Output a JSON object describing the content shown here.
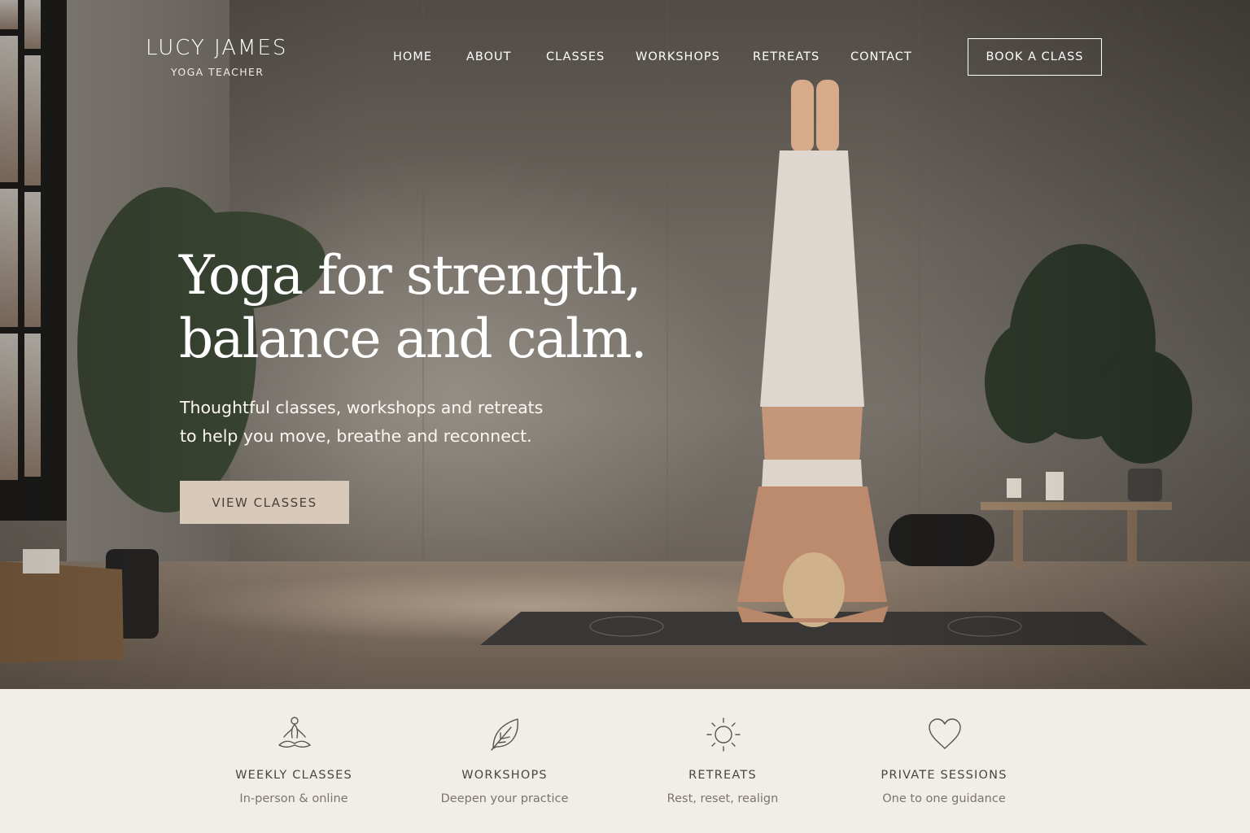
{
  "brand": {
    "name": "LUCY JAMES",
    "tagline": "YOGA TEACHER"
  },
  "nav": {
    "items": [
      {
        "label": "HOME"
      },
      {
        "label": "ABOUT"
      },
      {
        "label": "CLASSES"
      },
      {
        "label": "WORKSHOPS"
      },
      {
        "label": "RETREATS"
      },
      {
        "label": "CONTACT"
      }
    ],
    "cta_label": "BOOK A CLASS"
  },
  "hero": {
    "headline_line1": "Yoga for strength,",
    "headline_line2": "balance and calm.",
    "subtext_line1": "Thoughtful classes, workshops and retreats",
    "subtext_line2": "to help you move, breathe and reconnect.",
    "cta_label": "VIEW CLASSES"
  },
  "features": [
    {
      "icon": "meditation-icon",
      "title": "WEEKLY CLASSES",
      "subtitle": "In-person & online"
    },
    {
      "icon": "leaf-icon",
      "title": "WORKSHOPS",
      "subtitle": "Deepen your practice"
    },
    {
      "icon": "sun-icon",
      "title": "RETREATS",
      "subtitle": "Rest, reset, realign"
    },
    {
      "icon": "heart-icon",
      "title": "PRIVATE SESSIONS",
      "subtitle": "One to one guidance"
    }
  ],
  "colors": {
    "cta_background": "#d8c9b9",
    "features_background": "#f1ede7",
    "text_dark": "#4b4541"
  }
}
